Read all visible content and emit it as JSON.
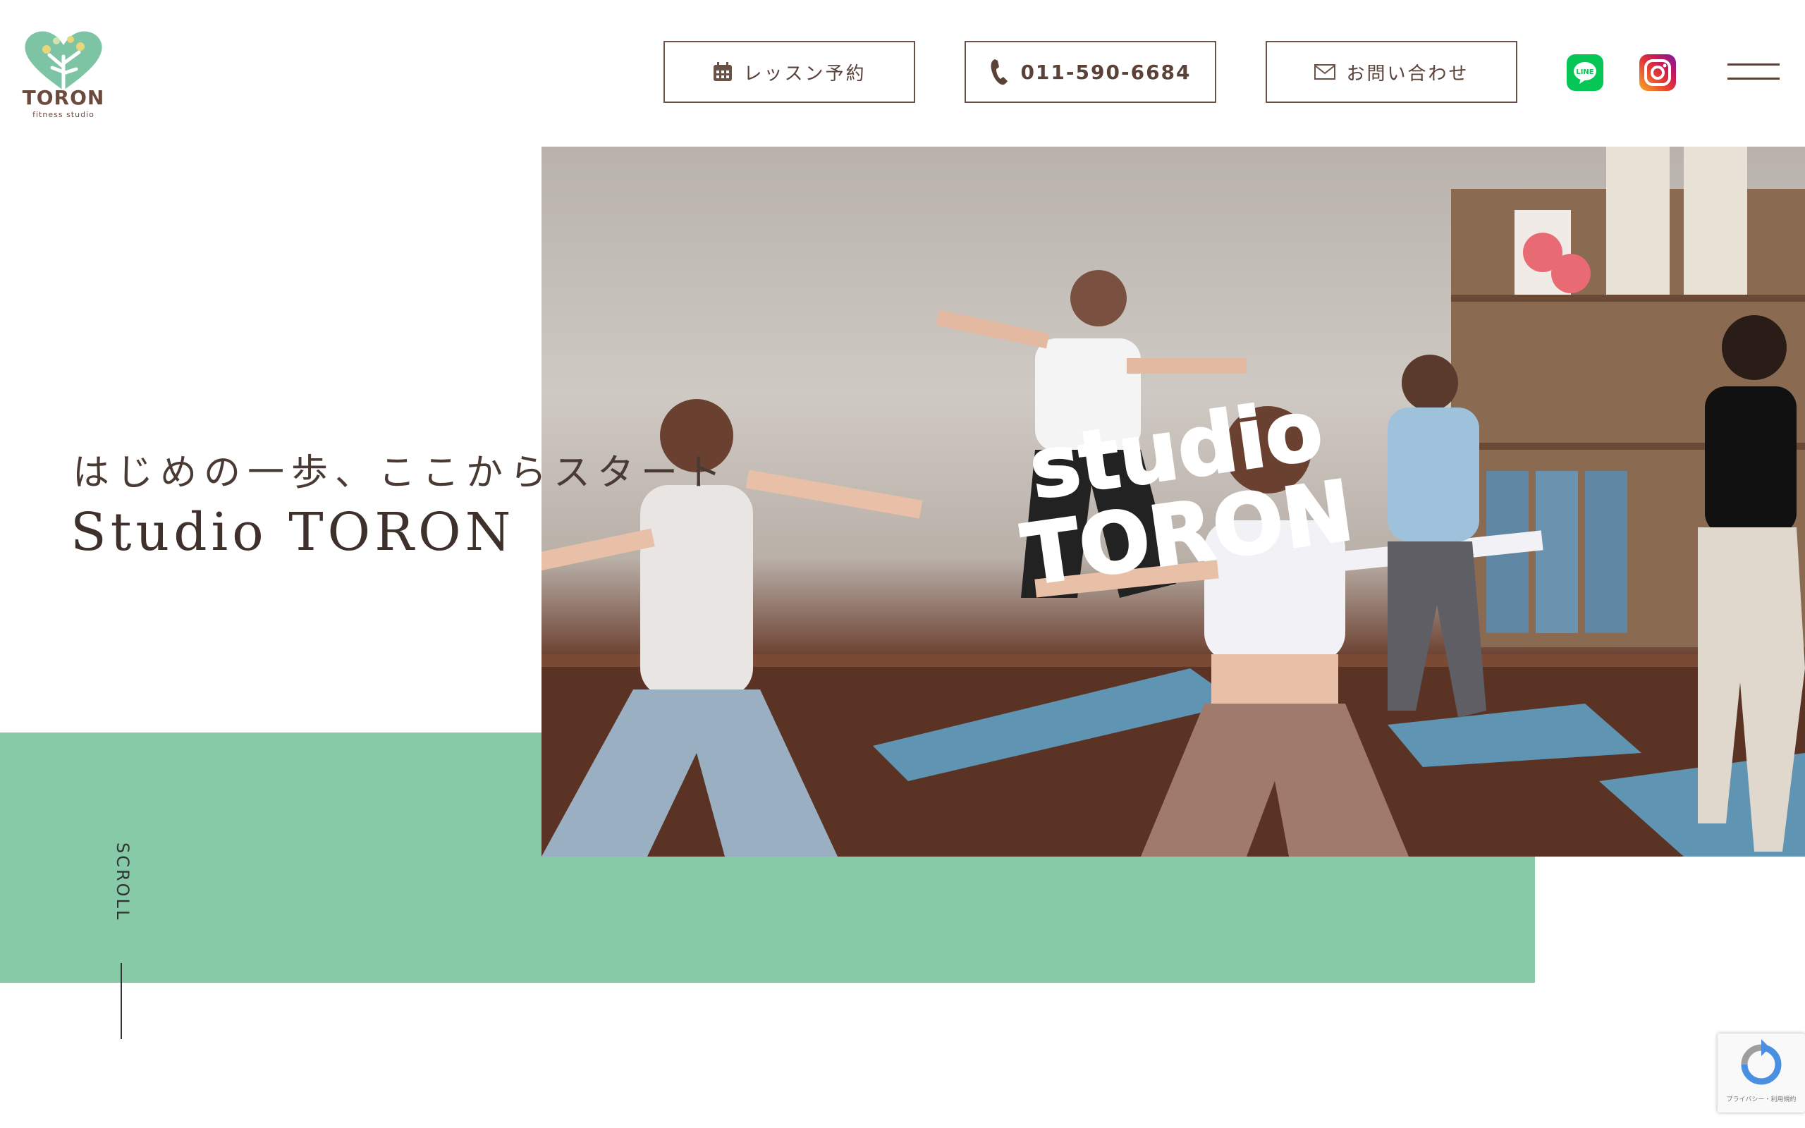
{
  "logo": {
    "word": "TORON",
    "sub": "fitness studio"
  },
  "header": {
    "lesson_label": "レッスン予約",
    "phone_label": "011-590-6684",
    "contact_label": "お問い合わせ",
    "line_icon": "line-icon",
    "instagram_icon": "instagram-icon"
  },
  "hero": {
    "tagline": "はじめの一歩、ここからスタート",
    "title": "Studio TORON",
    "overlay_logo_line1": "studio",
    "overlay_logo_line2": "TORON",
    "scroll_label": "SCROLL"
  },
  "recaptcha": {
    "text": "プライバシー・利用規約"
  },
  "colors": {
    "accent_green": "#86caa8",
    "brown": "#5a4238"
  }
}
